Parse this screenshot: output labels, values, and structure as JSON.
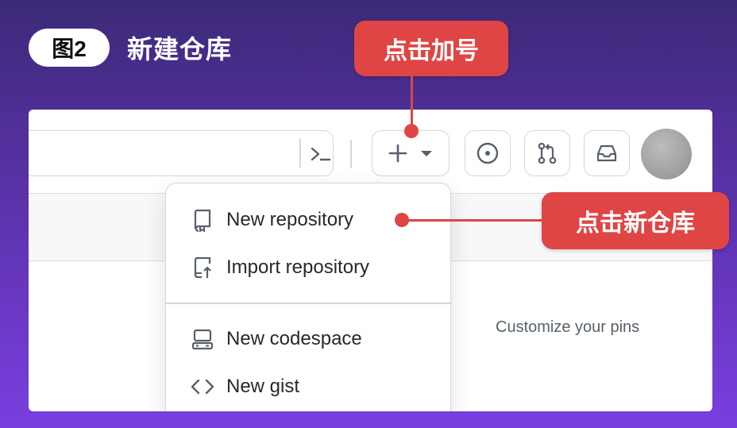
{
  "header": {
    "figure_label": "图2",
    "title": "新建仓库"
  },
  "callouts": {
    "plus": "点击加号",
    "new_repo": "点击新仓库"
  },
  "toolbar": {
    "command_icon": "terminal-prompt-icon",
    "create_icon": "plus-icon",
    "create_caret": "caret-down-icon",
    "issues_icon": "issue-opened-icon",
    "pulls_icon": "git-pull-request-icon",
    "inbox_icon": "inbox-icon"
  },
  "menu": {
    "items": [
      {
        "label": "New repository",
        "icon": "repo-icon"
      },
      {
        "label": "Import repository",
        "icon": "repo-push-icon"
      },
      {
        "label": "New codespace",
        "icon": "codespaces-icon"
      },
      {
        "label": "New gist",
        "icon": "code-icon"
      }
    ]
  },
  "main": {
    "pins_link": "Customize your pins"
  },
  "colors": {
    "accent_red": "#e04545",
    "background_purple": "#5a32a8"
  }
}
